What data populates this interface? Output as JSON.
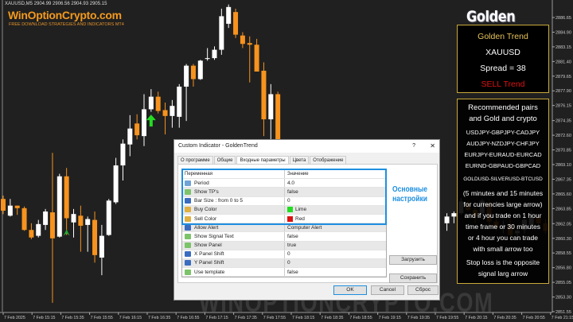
{
  "chart_header": "XAUUSD,M5  2904.99 2906.56 2904.93 2905.15",
  "brand": {
    "name": "WinOptionCrypto.com",
    "tagline": "FREE DOWNLOAD STRATEGIES AND INDICATORS MT4",
    "watermark": "WINOPTIONCRYPTO.COM"
  },
  "colors": {
    "background": "#202020",
    "bull": "#ffffff",
    "bear": "#f7931e",
    "arrow": "#22dd22",
    "panel_border": "#c9a93a",
    "highlight": "#1e8fe0"
  },
  "chart_data": {
    "type": "candlestick",
    "symbol": "XAUUSD",
    "timeframe": "M5",
    "y_ticks": [
      "2886.65",
      "2884.90",
      "2883.15",
      "2881.40",
      "2879.65",
      "2877.90",
      "2876.15",
      "2874.35",
      "2872.60",
      "2870.85",
      "2869.10",
      "2867.35",
      "2865.60",
      "2863.85",
      "2862.05",
      "2860.30",
      "2858.55",
      "2856.80",
      "2855.05",
      "2853.30",
      "2851.55"
    ],
    "ylim": [
      2851.55,
      2886.65
    ],
    "x_ticks": [
      "7 Feb 2025",
      "7 Feb 15:15",
      "7 Feb 15:35",
      "7 Feb 15:55",
      "7 Feb 16:15",
      "7 Feb 16:35",
      "7 Feb 16:55",
      "7 Feb 17:15",
      "7 Feb 17:35",
      "7 Feb 17:55",
      "7 Feb 18:15",
      "7 Feb 18:35",
      "7 Feb 18:55",
      "7 Feb 19:15",
      "7 Feb 19:35",
      "7 Feb 19:55",
      "7 Feb 20:15",
      "7 Feb 20:35",
      "7 Feb 20:55",
      "7 Feb 21:15"
    ],
    "candles_ohlc": [
      [
        2865.0,
        2865.4,
        2863.2,
        2863.6
      ],
      [
        2863.0,
        2865.0,
        2862.9,
        2864.2
      ],
      [
        2864.2,
        2864.2,
        2863.1,
        2863.9
      ],
      [
        2863.9,
        2864.1,
        2861.2,
        2861.3
      ],
      [
        2861.3,
        2862.1,
        2860.2,
        2860.4
      ],
      [
        2860.6,
        2862.5,
        2860.4,
        2862.0
      ],
      [
        2861.9,
        2863.8,
        2861.3,
        2863.5
      ],
      [
        2863.4,
        2870.5,
        2852.6,
        2860.3
      ],
      [
        2860.5,
        2868.0,
        2860.4,
        2867.7
      ],
      [
        2867.7,
        2868.7,
        2860.7,
        2862.7
      ],
      [
        2862.2,
        2863.8,
        2860.4,
        2863.2
      ],
      [
        2863.0,
        2864.2,
        2858.7,
        2861.8
      ],
      [
        2861.9,
        2862.9,
        2858.7,
        2862.6
      ],
      [
        2862.5,
        2863.5,
        2857.4,
        2858.3
      ],
      [
        2858.0,
        2861.9,
        2855.9,
        2860.6
      ],
      [
        2860.7,
        2865.0,
        2860.6,
        2864.8
      ],
      [
        2864.6,
        2869.9,
        2864.4,
        2869.0
      ],
      [
        2869.0,
        2872.1,
        2867.2,
        2871.6
      ],
      [
        2871.5,
        2875.0,
        2870.1,
        2873.4
      ],
      [
        2874.0,
        2875.1,
        2872.1,
        2872.6
      ],
      [
        2872.5,
        2877.5,
        2871.3,
        2875.7
      ],
      [
        2875.7,
        2878.1,
        2875.4,
        2877.2
      ],
      [
        2877.2,
        2877.8,
        2875.2,
        2875.5
      ],
      [
        2875.6,
        2876.5,
        2872.7,
        2874.9
      ],
      [
        2874.9,
        2876.8,
        2873.5,
        2876.1
      ],
      [
        2874.8,
        2878.7,
        2873.5,
        2878.4
      ],
      [
        2878.4,
        2881.1,
        2874.3,
        2880.9
      ],
      [
        2880.9,
        2881.1,
        2878.4,
        2879.3
      ],
      [
        2879.3,
        2881.6,
        2879.2,
        2881.5
      ],
      [
        2881.7,
        2883.0,
        2881.5,
        2881.8
      ],
      [
        2881.8,
        2883.2,
        2881.6,
        2882.8
      ],
      [
        2882.8,
        2887.7,
        2882.2,
        2886.8
      ],
      [
        2885.9,
        2888.2,
        2885.4,
        2887.9
      ],
      [
        2887.3,
        2887.7,
        2884.2,
        2884.6
      ],
      [
        2884.5,
        2884.9,
        2883.0,
        2883.5
      ],
      [
        2883.6,
        2884.4,
        2878.9,
        2883.4
      ],
      [
        2883.4,
        2884.1,
        2880.2,
        2880.2
      ],
      [
        2880.3,
        2881.3,
        2872.5,
        2874.5
      ],
      [
        2874.5,
        2878.7,
        2872.1,
        2877.5
      ],
      [
        2877.5,
        2877.8,
        2871.8,
        2872.1
      ],
      null,
      null,
      null,
      null,
      null,
      null,
      null,
      null,
      null,
      null,
      null,
      null,
      null,
      null,
      null,
      null,
      null,
      null,
      null,
      null,
      null,
      null,
      null,
      [
        2862.1,
        2863.3,
        2861.2,
        2862.9
      ],
      [
        2862.9,
        2863.5,
        2862.1,
        2863.3
      ],
      [
        2863.3,
        2865.1,
        2863.1,
        2864.7
      ],
      [
        2864.5,
        2864.8,
        2863.5,
        2863.7
      ],
      [
        2863.7,
        2864.2,
        2862.1,
        2862.9
      ],
      [
        2863.3,
        2865.0,
        2862.6,
        2864.8
      ],
      [
        2864.5,
        2865.0,
        2861.6,
        2862.3
      ],
      [
        2862.3,
        2862.9,
        2861.2,
        2861.6
      ],
      [
        2861.6,
        2862.4,
        2860.9,
        2861.8
      ],
      [
        2861.9,
        2862.6,
        2860.6,
        2860.7
      ],
      [
        2860.9,
        2861.6,
        2860.4,
        2861.2
      ],
      [
        2861.3,
        2862.9,
        2860.9,
        2862.5
      ],
      [
        2861.9,
        2863.5,
        2861.6,
        2862.8
      ],
      [
        2862.8,
        2863.1,
        2861.9,
        2862.1
      ],
      [
        2862.1,
        2862.6,
        2860.9,
        2861.2
      ]
    ],
    "signals": [
      {
        "type": "buy-large-arrow",
        "candle": 21,
        "price": 2874.4
      },
      {
        "type": "buy-small-arrow",
        "candle": 9,
        "price": 2860.9
      }
    ]
  },
  "panel": {
    "title": "Golden Trend",
    "status": {
      "name": "Golden Trend",
      "symbol": "XAUUSD",
      "spread": "Spread = 38",
      "trend": "SELL Trend"
    },
    "info": [
      "Recommended pairs",
      "and Gold and crypto",
      "USDJPY-GBPJPY-CADJPY",
      "AUDJPY-NZDJPY-CHFJPY",
      "EURJPY-EURAUD-EURCAD",
      "EURND-GBPAUD-GBPCAD",
      "GOLDUSD-SILVERUSD-BTCUSD",
      "(5 minutes and 15 minutes",
      "for currencies large arrow)",
      "and if you trade on 1 hour",
      "time frame or 30 minutes",
      "or 4 hour you can trade",
      "with small arrow too",
      "Stop loss is the opposite",
      "signal larg arrow"
    ]
  },
  "dialog": {
    "title": "Custom Indicator - GoldenTrend",
    "help": "?",
    "close": "✕",
    "tabs": [
      "О программе",
      "Общие",
      "Входные параметры",
      "Цвета",
      "Отображение"
    ],
    "active_tab": "Входные параметры",
    "columns": [
      "Переменная",
      "Значение"
    ],
    "params": [
      {
        "name": "Period",
        "value": "4.0",
        "type": "num"
      },
      {
        "name": "Show TP's",
        "value": "false",
        "type": "bool"
      },
      {
        "name": "Bar Size : from 0 to 5",
        "value": "0",
        "type": "en"
      },
      {
        "name": "Buy Color",
        "value": "Lime",
        "type": "col",
        "swatch": "#22dd22"
      },
      {
        "name": "Sell Color",
        "value": "Red",
        "type": "col",
        "swatch": "#dd1111"
      },
      {
        "name": "Allow Alert",
        "value": "Computer Alert",
        "type": "en"
      },
      {
        "name": "Show Signal Text",
        "value": "false",
        "type": "bool"
      },
      {
        "name": "Show Panel",
        "value": "true",
        "type": "bool"
      },
      {
        "name": "X Panel Shift",
        "value": "0",
        "type": "en"
      },
      {
        "name": "Y Panel Shift",
        "value": "0",
        "type": "en"
      },
      {
        "name": "Use template",
        "value": "false",
        "type": "bool"
      }
    ],
    "annotation": [
      "Основные",
      "настройки"
    ],
    "load": "Загрузить",
    "save": "Сохранить",
    "ok": "OK",
    "cancel": "Cancel",
    "reset": "Сброс"
  }
}
